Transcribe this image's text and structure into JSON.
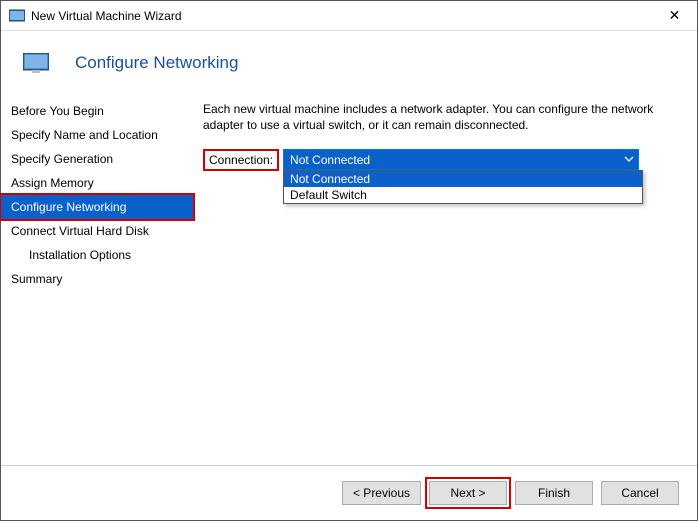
{
  "window": {
    "title": "New Virtual Machine Wizard"
  },
  "colors": {
    "highlight": "#d40000",
    "selection": "#0a61cb",
    "title_text": "#1a4f9c"
  },
  "header": {
    "page_title": "Configure Networking"
  },
  "sidebar": {
    "items": [
      {
        "label": "Before You Begin",
        "selected": false,
        "indent": false
      },
      {
        "label": "Specify Name and Location",
        "selected": false,
        "indent": false
      },
      {
        "label": "Specify Generation",
        "selected": false,
        "indent": false
      },
      {
        "label": "Assign Memory",
        "selected": false,
        "indent": false
      },
      {
        "label": "Configure Networking",
        "selected": true,
        "indent": false
      },
      {
        "label": "Connect Virtual Hard Disk",
        "selected": false,
        "indent": false
      },
      {
        "label": "Installation Options",
        "selected": false,
        "indent": true
      },
      {
        "label": "Summary",
        "selected": false,
        "indent": false
      }
    ]
  },
  "main": {
    "description": "Each new virtual machine includes a network adapter. You can configure the network adapter to use a virtual switch, or it can remain disconnected.",
    "connection_label": "Connection:",
    "connection_selected": "Not Connected",
    "connection_options": [
      {
        "label": "Not Connected",
        "highlighted": true
      },
      {
        "label": "Default Switch",
        "highlighted": false
      }
    ]
  },
  "footer": {
    "previous": "< Previous",
    "next": "Next >",
    "finish": "Finish",
    "cancel": "Cancel"
  }
}
